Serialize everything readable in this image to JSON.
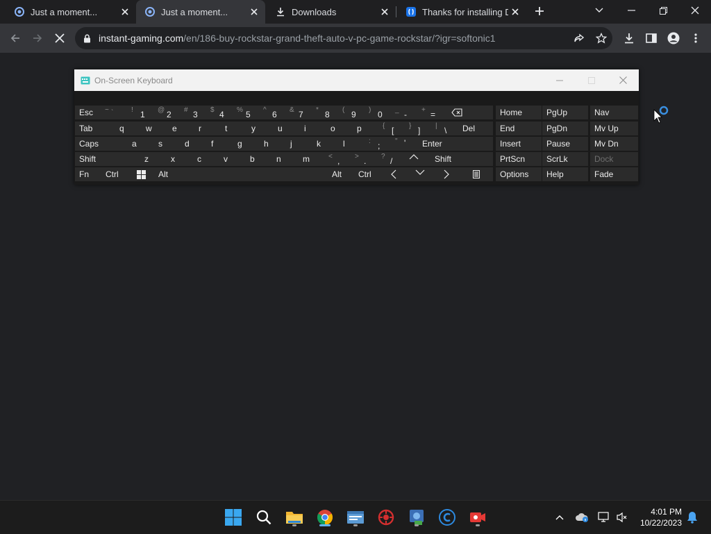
{
  "browser": {
    "tabs": [
      {
        "title": "Just a moment...",
        "icon": "spinner-favicon",
        "active": false
      },
      {
        "title": "Just a moment...",
        "icon": "spinner-favicon",
        "active": true
      },
      {
        "title": "Downloads",
        "icon": "download-icon",
        "active": false
      },
      {
        "title": "Thanks for installing Dr",
        "icon": "softonic-favicon",
        "active": false
      }
    ],
    "url_host": "instant-gaming.com",
    "url_path": "/en/186-buy-rockstar-grand-theft-auto-v-pc-game-rockstar/?igr=softonic1"
  },
  "osk": {
    "title": "On-Screen Keyboard",
    "rows": [
      [
        {
          "label": "Esc"
        },
        {
          "shift": "~",
          "main": "`"
        },
        {
          "shift": "!",
          "main": "1"
        },
        {
          "shift": "@",
          "main": "2"
        },
        {
          "shift": "#",
          "main": "3"
        },
        {
          "shift": "$",
          "main": "4"
        },
        {
          "shift": "%",
          "main": "5"
        },
        {
          "shift": "^",
          "main": "6"
        },
        {
          "shift": "&",
          "main": "7"
        },
        {
          "shift": "*",
          "main": "8"
        },
        {
          "shift": "(",
          "main": "9"
        },
        {
          "shift": ")",
          "main": "0"
        },
        {
          "shift": "_",
          "main": "-"
        },
        {
          "shift": "+",
          "main": "="
        },
        {
          "icon": "backspace-icon"
        }
      ],
      [
        {
          "label": "Tab"
        },
        {
          "label": "q"
        },
        {
          "label": "w"
        },
        {
          "label": "e"
        },
        {
          "label": "r"
        },
        {
          "label": "t"
        },
        {
          "label": "y"
        },
        {
          "label": "u"
        },
        {
          "label": "i"
        },
        {
          "label": "o"
        },
        {
          "label": "p"
        },
        {
          "shift": "{",
          "main": "["
        },
        {
          "shift": "}",
          "main": "]"
        },
        {
          "shift": "|",
          "main": "\\"
        },
        {
          "label": "Del"
        }
      ],
      [
        {
          "label": "Caps"
        },
        {
          "label": "a"
        },
        {
          "label": "s"
        },
        {
          "label": "d"
        },
        {
          "label": "f"
        },
        {
          "label": "g"
        },
        {
          "label": "h"
        },
        {
          "label": "j"
        },
        {
          "label": "k"
        },
        {
          "label": "l"
        },
        {
          "shift": ":",
          "main": ";"
        },
        {
          "shift": "\"",
          "main": "'"
        },
        {
          "label": "Enter"
        }
      ],
      [
        {
          "label": "Shift"
        },
        {
          "label": "z"
        },
        {
          "label": "x"
        },
        {
          "label": "c"
        },
        {
          "label": "v"
        },
        {
          "label": "b"
        },
        {
          "label": "n"
        },
        {
          "label": "m"
        },
        {
          "shift": "<",
          "main": ","
        },
        {
          "shift": ">",
          "main": "."
        },
        {
          "shift": "?",
          "main": "/"
        },
        {
          "icon": "up-arrow-icon"
        },
        {
          "label": "Shift"
        }
      ],
      [
        {
          "label": "Fn"
        },
        {
          "label": "Ctrl"
        },
        {
          "icon": "windows-icon"
        },
        {
          "label": "Alt"
        },
        {
          "label": ""
        },
        {
          "label": "Alt"
        },
        {
          "label": "Ctrl"
        },
        {
          "icon": "left-arrow-icon"
        },
        {
          "icon": "down-arrow-icon"
        },
        {
          "icon": "right-arrow-icon"
        },
        {
          "icon": "menu-icon"
        }
      ]
    ],
    "nav_rows": [
      [
        {
          "label": "Home"
        },
        {
          "label": "PgUp"
        },
        {
          "label": "Nav"
        }
      ],
      [
        {
          "label": "End"
        },
        {
          "label": "PgDn"
        },
        {
          "label": "Mv Up"
        }
      ],
      [
        {
          "label": "Insert"
        },
        {
          "label": "Pause"
        },
        {
          "label": "Mv Dn"
        }
      ],
      [
        {
          "label": "PrtScn"
        },
        {
          "label": "ScrLk"
        },
        {
          "label": "Dock",
          "disabled": true
        }
      ],
      [
        {
          "label": "Options"
        },
        {
          "label": "Help"
        },
        {
          "label": "Fade"
        }
      ]
    ]
  },
  "taskbar": {
    "apps": [
      "windows-start-icon",
      "search-icon",
      "file-explorer-icon",
      "chrome-icon",
      "app-icon",
      "antivirus-icon",
      "network-app-icon",
      "ccleaner-icon",
      "recorder-icon"
    ],
    "time": "4:01 PM",
    "date": "10/22/2023"
  }
}
